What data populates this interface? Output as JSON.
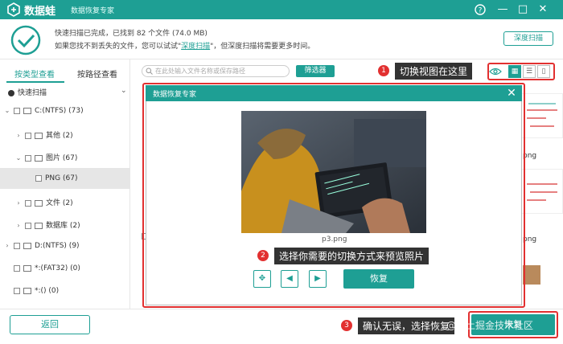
{
  "titlebar": {
    "app_name": "数据蛙",
    "window_title": "数据恢复专家",
    "help_icon": "help-circle-icon",
    "minimize_icon": "minimize-icon",
    "maximize_icon": "maximize-icon",
    "close_icon": "close-icon"
  },
  "notice": {
    "line1": "快速扫描已完成，已找到 82 个文件 (74.0 MB)",
    "line2_prefix": "如果您找不到丢失的文件，您可以试试\"",
    "line2_link": "深度扫描",
    "line2_suffix": "\"，但深度扫描将需要更多时间。",
    "deep_scan_button": "深度扫描"
  },
  "sidebar": {
    "tabs": [
      "按类型查看",
      "按路径查看"
    ],
    "active_tab": 0,
    "scan_label": "快速扫描",
    "tree": [
      {
        "label": "C:(NTFS) (73)",
        "level": 0
      },
      {
        "label": "其他 (2)",
        "level": 1
      },
      {
        "label": "图片 (67)",
        "level": 1
      },
      {
        "label": "PNG (67)",
        "level": 2,
        "selected": true
      },
      {
        "label": "文件 (2)",
        "level": 1
      },
      {
        "label": "数据库 (2)",
        "level": 1
      },
      {
        "label": "D:(NTFS) (9)",
        "level": 0
      },
      {
        "label": "*:(FAT32) (0)",
        "level": 0
      },
      {
        "label": "*:() (0)",
        "level": 0
      }
    ]
  },
  "toolbar": {
    "search_placeholder": "在此处输入文件名称或保存路径",
    "filter_button": "筛选器"
  },
  "callouts": [
    {
      "num": "1",
      "text": "切换视图在这里"
    },
    {
      "num": "2",
      "text": "选择你需要的切换方式来预览照片"
    },
    {
      "num": "3",
      "text": "确认无误，选择恢复"
    }
  ],
  "grid": {
    "partial_labels": [
      "png",
      "png"
    ]
  },
  "dialog": {
    "title": "数据恢复专家",
    "caption": "p3.png",
    "restore_button": "恢复"
  },
  "bottom": {
    "back_button": "返回",
    "recover_button": "恢复",
    "watermark": "@稀土掘金技术社区"
  },
  "colors": {
    "accent": "#1e9f94",
    "highlight": "#e23030"
  }
}
